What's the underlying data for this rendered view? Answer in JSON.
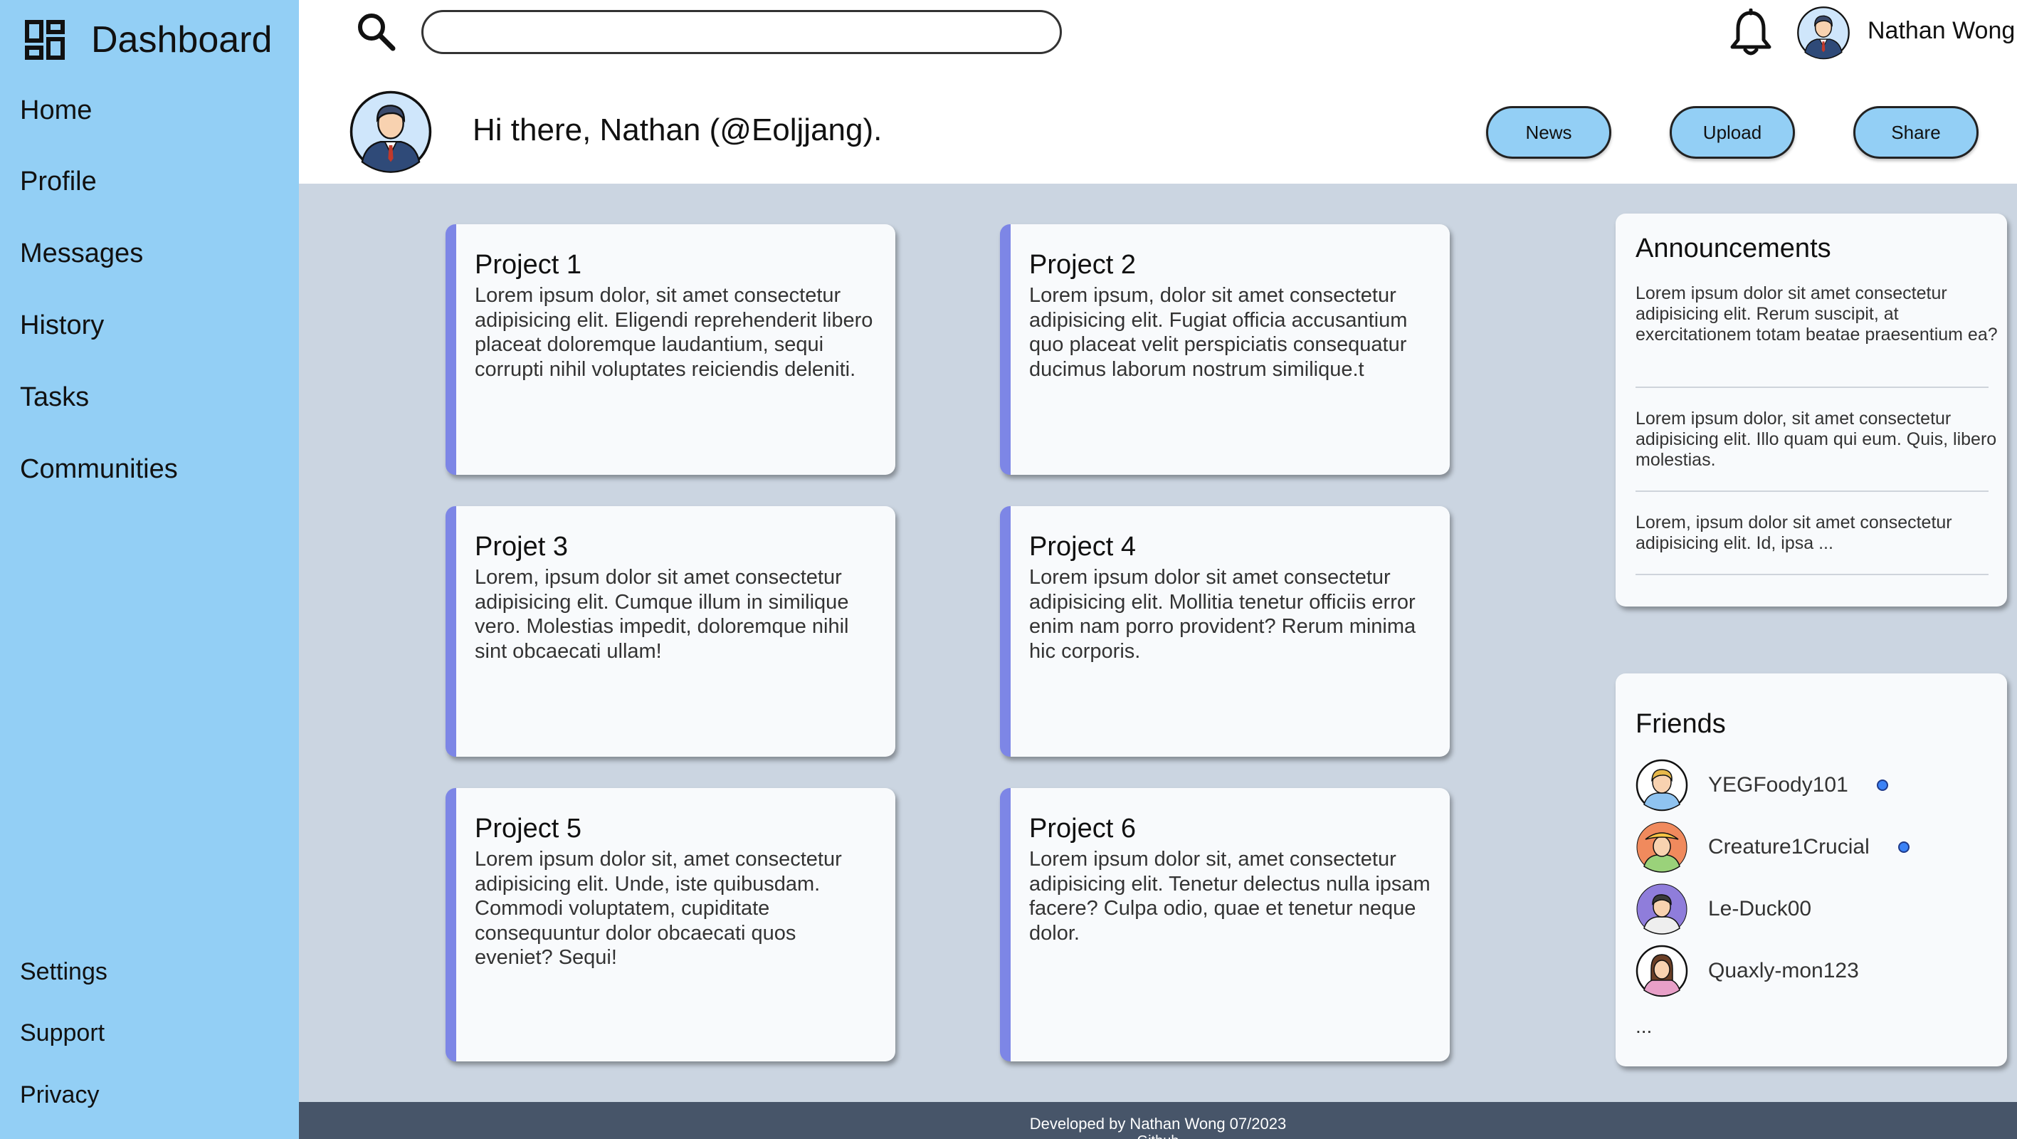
{
  "sidebar": {
    "title": "Dashboard",
    "logo_icon": "dashboard-grid-icon",
    "items": [
      {
        "label": "Home"
      },
      {
        "label": "Profile"
      },
      {
        "label": "Messages"
      },
      {
        "label": "History"
      },
      {
        "label": "Tasks"
      },
      {
        "label": "Communities"
      }
    ],
    "bottom_items": [
      {
        "label": "Settings"
      },
      {
        "label": "Support"
      },
      {
        "label": "Privacy"
      }
    ]
  },
  "header": {
    "search": {
      "placeholder": "",
      "value": ""
    },
    "user_name": "Nathan Wong",
    "greeting": "Hi there, Nathan (@Eoljjang).",
    "buttons": [
      {
        "label": "News"
      },
      {
        "label": "Upload"
      },
      {
        "label": "Share"
      }
    ]
  },
  "projects": [
    {
      "title": "Project 1",
      "description": "Lorem ipsum dolor, sit amet consectetur adipisicing elit. Eligendi reprehenderit libero placeat doloremque laudantium, sequi corrupti nihil voluptates reiciendis deleniti."
    },
    {
      "title": "Project 2",
      "description": "Lorem ipsum, dolor sit amet consectetur adipisicing elit. Fugiat officia accusantium quo placeat velit perspiciatis consequatur ducimus laborum nostrum similique.t"
    },
    {
      "title": "Projet 3",
      "description": "Lorem, ipsum dolor sit amet consectetur adipisicing elit. Cumque illum in similique vero. Molestias impedit, doloremque nihil sint obcaecati ullam!"
    },
    {
      "title": "Project 4",
      "description": "Lorem ipsum dolor sit amet consectetur adipisicing elit. Mollitia tenetur officiis error enim nam porro provident? Rerum minima hic corporis."
    },
    {
      "title": "Project 5",
      "description": "Lorem ipsum dolor sit, amet consectetur adipisicing elit. Unde, iste quibusdam. Commodi voluptatem, cupiditate consequuntur dolor obcaecati quos eveniet? Sequi!"
    },
    {
      "title": "Project 6",
      "description": "Lorem ipsum dolor sit, amet consectetur adipisicing elit. Tenetur delectus nulla ipsam facere? Culpa odio, quae et tenetur neque dolor."
    }
  ],
  "announcements": {
    "title": "Announcements",
    "items": [
      {
        "text": "Lorem ipsum dolor sit amet consectetur adipisicing elit. Rerum suscipit, at exercitationem totam beatae praesentium ea?"
      },
      {
        "text": "Lorem ipsum dolor, sit amet consectetur adipisicing elit. Illo quam qui eum. Quis, libero molestias."
      },
      {
        "text": "Lorem, ipsum dolor sit amet consectetur adipisicing elit. Id, ipsa ..."
      }
    ]
  },
  "friends": {
    "title": "Friends",
    "items": [
      {
        "name": "YEGFoody101",
        "online": true
      },
      {
        "name": "Creature1Crucial",
        "online": true
      },
      {
        "name": "Le-Duck00",
        "online": false
      },
      {
        "name": "Quaxly-mon123",
        "online": false
      }
    ],
    "more": "..."
  },
  "footer": {
    "text": "Developed by Nathan Wong 07/2023",
    "sub": "Github"
  },
  "colors": {
    "sidebar": "#93cff5",
    "content_bg": "#cbd5e1",
    "card_accent": "#7d86e6",
    "footer": "#475569",
    "online": "#3b82f6"
  }
}
